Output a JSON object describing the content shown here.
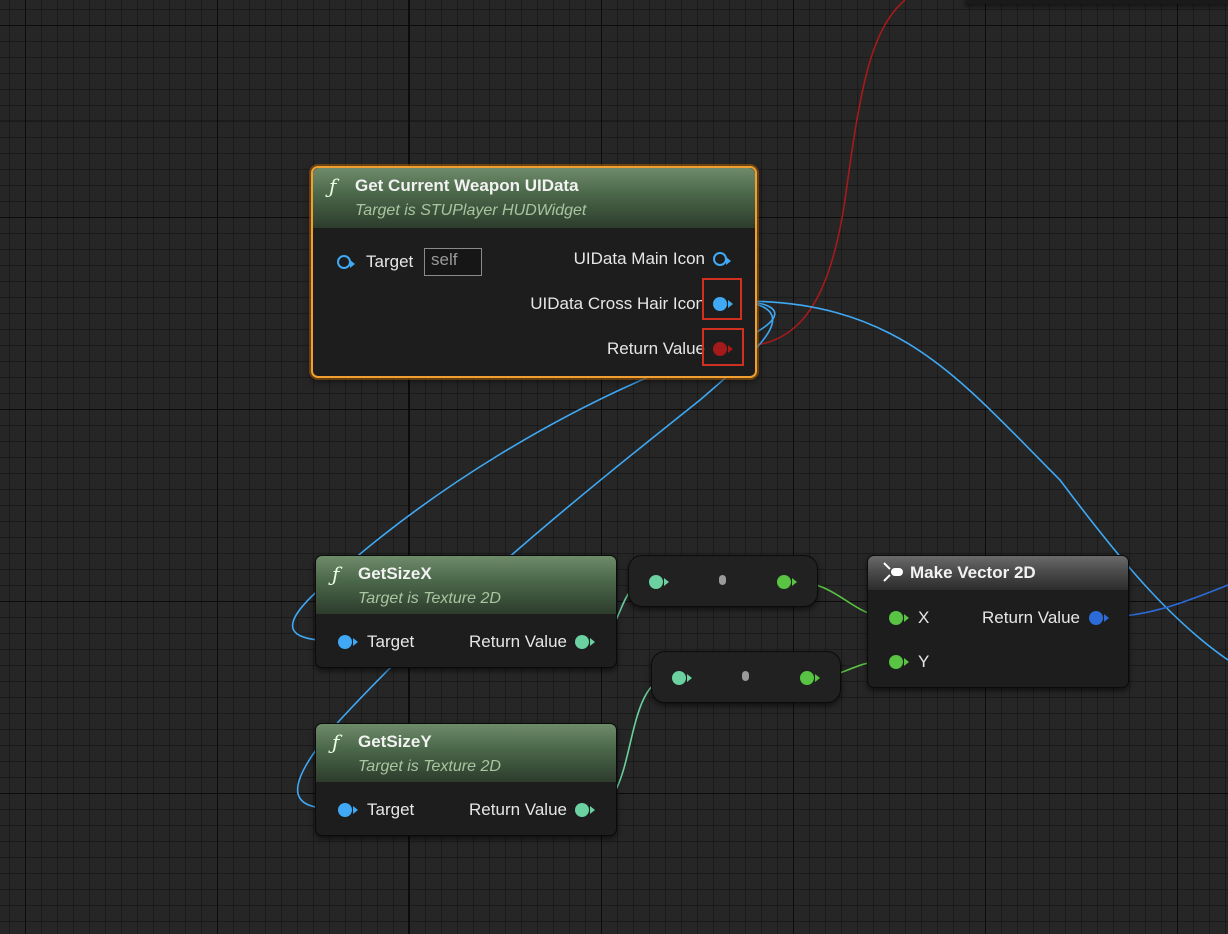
{
  "nodes": {
    "get_weapon": {
      "title": "Get Current Weapon UIData",
      "subtitle": "Target is STUPlayer HUDWidget",
      "target_label": "Target",
      "target_default": "self",
      "out_main_icon": "UIData Main Icon",
      "out_cross_hair": "UIData Cross Hair Icon",
      "out_return": "Return Value"
    },
    "get_size_x": {
      "title": "GetSizeX",
      "subtitle": "Target is Texture 2D",
      "target_label": "Target",
      "out_return": "Return Value"
    },
    "get_size_y": {
      "title": "GetSizeY",
      "subtitle": "Target is Texture 2D",
      "target_label": "Target",
      "out_return": "Return Value"
    },
    "make_vector": {
      "title": "Make Vector 2D",
      "in_x": "X",
      "in_y": "Y",
      "out_return": "Return Value"
    }
  },
  "icons": {
    "function": "ƒ",
    "make_struct": "make-struct-icon"
  },
  "colors": {
    "object_pin": "#3fa9f5",
    "struct_pin": "#a51a1a",
    "float_pin": "#59c443",
    "int_pin": "#6bd1a0",
    "vector2d_pin": "#2c6ad8",
    "selection": "#f0a030",
    "highlight": "#d03020"
  }
}
